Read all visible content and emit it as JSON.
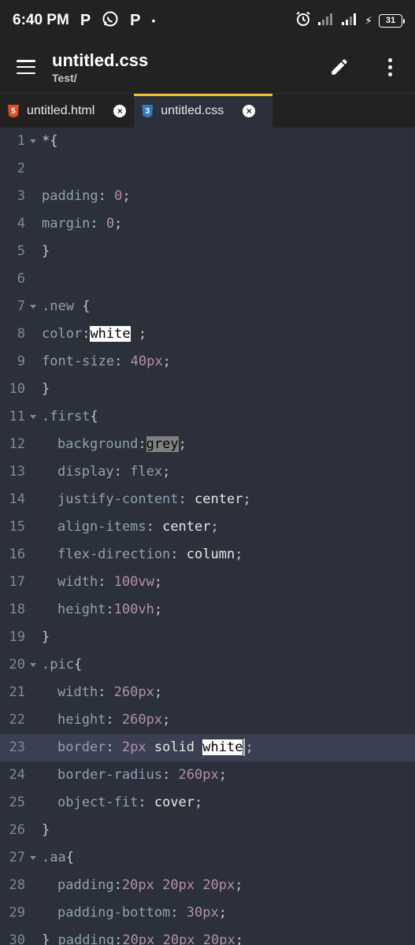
{
  "status_bar": {
    "time": "6:40 PM",
    "left_icons": [
      "p-notification-icon",
      "whatsapp-icon",
      "p-notification-icon",
      "dot-icon"
    ],
    "battery": "31"
  },
  "app_bar": {
    "title": "untitled.css",
    "subtitle": "Test/"
  },
  "tabs": [
    {
      "label": "untitled.html",
      "icon": "html5-file-icon",
      "active": false
    },
    {
      "label": "untitled.css",
      "icon": "css3-file-icon",
      "active": true
    }
  ],
  "colors": {
    "editor_bg": "#2b303b",
    "toolbar_bg": "#222222",
    "active_tab_indicator": "#f2c230",
    "property": "#8fa1b3",
    "number": "#b48ead",
    "line_number": "#7f8899"
  },
  "editor": {
    "lines": [
      {
        "n": "1",
        "fold": true,
        "tokens": [
          {
            "t": "*{",
            "c": "punct"
          }
        ]
      },
      {
        "n": "2",
        "tokens": []
      },
      {
        "n": "3",
        "tokens": [
          {
            "t": "padding",
            "c": "prop"
          },
          {
            "t": ": ",
            "c": "punct"
          },
          {
            "t": "0",
            "c": "num"
          },
          {
            "t": ";",
            "c": "punct"
          }
        ]
      },
      {
        "n": "4",
        "tokens": [
          {
            "t": "margin",
            "c": "prop"
          },
          {
            "t": ": ",
            "c": "punct"
          },
          {
            "t": "0",
            "c": "num"
          },
          {
            "t": ";",
            "c": "punct"
          }
        ]
      },
      {
        "n": "5",
        "tokens": [
          {
            "t": "}",
            "c": "punct"
          }
        ]
      },
      {
        "n": "6",
        "tokens": []
      },
      {
        "n": "7",
        "fold": true,
        "tokens": [
          {
            "t": ".new",
            "c": "sel"
          },
          {
            "t": " {",
            "c": "punct"
          }
        ]
      },
      {
        "n": "8",
        "tokens": [
          {
            "t": "color",
            "c": "prop"
          },
          {
            "t": ":",
            "c": "punct"
          },
          {
            "t": "white",
            "c": "swatch-white"
          },
          {
            "t": " ;",
            "c": "punct"
          }
        ]
      },
      {
        "n": "9",
        "tokens": [
          {
            "t": "font-size",
            "c": "prop"
          },
          {
            "t": ": ",
            "c": "punct"
          },
          {
            "t": "40px",
            "c": "num"
          },
          {
            "t": ";",
            "c": "punct"
          }
        ]
      },
      {
        "n": "10",
        "tokens": [
          {
            "t": "}",
            "c": "punct"
          }
        ]
      },
      {
        "n": "11",
        "fold": true,
        "tokens": [
          {
            "t": ".first",
            "c": "sel"
          },
          {
            "t": "{",
            "c": "punct"
          }
        ]
      },
      {
        "n": "12",
        "indent": true,
        "tokens": [
          {
            "t": "background",
            "c": "prop"
          },
          {
            "t": ":",
            "c": "punct"
          },
          {
            "t": "grey",
            "c": "swatch-grey"
          },
          {
            "t": ";",
            "c": "punct"
          }
        ]
      },
      {
        "n": "13",
        "indent": true,
        "tokens": [
          {
            "t": "display",
            "c": "prop"
          },
          {
            "t": ": ",
            "c": "punct"
          },
          {
            "t": "flex",
            "c": "prop"
          },
          {
            "t": ";",
            "c": "punct"
          }
        ]
      },
      {
        "n": "14",
        "indent": true,
        "tokens": [
          {
            "t": "justify-content",
            "c": "prop"
          },
          {
            "t": ": ",
            "c": "punct"
          },
          {
            "t": "center",
            "c": "val"
          },
          {
            "t": ";",
            "c": "punct"
          }
        ]
      },
      {
        "n": "15",
        "indent": true,
        "tokens": [
          {
            "t": "align-items",
            "c": "prop"
          },
          {
            "t": ": ",
            "c": "punct"
          },
          {
            "t": "center",
            "c": "val"
          },
          {
            "t": ";",
            "c": "punct"
          }
        ]
      },
      {
        "n": "16",
        "indent": true,
        "tokens": [
          {
            "t": "flex-direction",
            "c": "prop"
          },
          {
            "t": ": ",
            "c": "punct"
          },
          {
            "t": "column",
            "c": "val"
          },
          {
            "t": ";",
            "c": "punct"
          }
        ]
      },
      {
        "n": "17",
        "indent": true,
        "tokens": [
          {
            "t": "width",
            "c": "prop"
          },
          {
            "t": ": ",
            "c": "punct"
          },
          {
            "t": "100vw",
            "c": "num"
          },
          {
            "t": ";",
            "c": "punct"
          }
        ]
      },
      {
        "n": "18",
        "indent": true,
        "tokens": [
          {
            "t": "height",
            "c": "prop"
          },
          {
            "t": ":",
            "c": "punct"
          },
          {
            "t": "100vh",
            "c": "num"
          },
          {
            "t": ";",
            "c": "punct"
          }
        ]
      },
      {
        "n": "19",
        "tokens": [
          {
            "t": "}",
            "c": "punct"
          }
        ]
      },
      {
        "n": "20",
        "fold": true,
        "tokens": [
          {
            "t": ".pic",
            "c": "sel"
          },
          {
            "t": "{",
            "c": "punct"
          }
        ]
      },
      {
        "n": "21",
        "indent": true,
        "tokens": [
          {
            "t": "width",
            "c": "prop"
          },
          {
            "t": ": ",
            "c": "punct"
          },
          {
            "t": "260px",
            "c": "num"
          },
          {
            "t": ";",
            "c": "punct"
          }
        ]
      },
      {
        "n": "22",
        "indent": true,
        "tokens": [
          {
            "t": "height",
            "c": "prop"
          },
          {
            "t": ": ",
            "c": "punct"
          },
          {
            "t": "260px",
            "c": "num"
          },
          {
            "t": ";",
            "c": "punct"
          }
        ]
      },
      {
        "n": "23",
        "indent": true,
        "current": true,
        "tokens": [
          {
            "t": "border",
            "c": "prop"
          },
          {
            "t": ": ",
            "c": "punct"
          },
          {
            "t": "2px",
            "c": "num"
          },
          {
            "t": " solid ",
            "c": "val"
          },
          {
            "t": "white",
            "c": "swatch-white"
          },
          {
            "t": "|",
            "c": "cursor"
          },
          {
            "t": ";",
            "c": "punct"
          }
        ]
      },
      {
        "n": "24",
        "indent": true,
        "tokens": [
          {
            "t": "border-radius",
            "c": "prop"
          },
          {
            "t": ": ",
            "c": "punct"
          },
          {
            "t": "260px",
            "c": "num"
          },
          {
            "t": ";",
            "c": "punct"
          }
        ]
      },
      {
        "n": "25",
        "indent": true,
        "tokens": [
          {
            "t": "object-fit",
            "c": "prop"
          },
          {
            "t": ": ",
            "c": "punct"
          },
          {
            "t": "cover",
            "c": "val"
          },
          {
            "t": ";",
            "c": "punct"
          }
        ]
      },
      {
        "n": "26",
        "tokens": [
          {
            "t": "}",
            "c": "punct"
          }
        ]
      },
      {
        "n": "27",
        "fold": true,
        "tokens": [
          {
            "t": ".aa",
            "c": "sel"
          },
          {
            "t": "{",
            "c": "punct"
          }
        ]
      },
      {
        "n": "28",
        "indent": true,
        "tokens": [
          {
            "t": "padding",
            "c": "prop"
          },
          {
            "t": ":",
            "c": "punct"
          },
          {
            "t": "20px",
            "c": "num"
          },
          {
            "t": " ",
            "c": "punct"
          },
          {
            "t": "20px",
            "c": "num"
          },
          {
            "t": " ",
            "c": "punct"
          },
          {
            "t": "20px",
            "c": "num"
          },
          {
            "t": ";",
            "c": "punct"
          }
        ]
      },
      {
        "n": "29",
        "indent": true,
        "tokens": [
          {
            "t": "padding-bottom",
            "c": "prop"
          },
          {
            "t": ": ",
            "c": "punct"
          },
          {
            "t": "30px",
            "c": "num"
          },
          {
            "t": ";",
            "c": "punct"
          }
        ]
      },
      {
        "n": "30",
        "tokens": [
          {
            "t": "} ",
            "c": "punct"
          },
          {
            "t": "padding",
            "c": "prop"
          },
          {
            "t": ":",
            "c": "punct"
          },
          {
            "t": "20px",
            "c": "num"
          },
          {
            "t": " ",
            "c": "punct"
          },
          {
            "t": "20px",
            "c": "num"
          },
          {
            "t": " ",
            "c": "punct"
          },
          {
            "t": "20px",
            "c": "num"
          },
          {
            "t": ";",
            "c": "punct"
          }
        ]
      }
    ]
  }
}
